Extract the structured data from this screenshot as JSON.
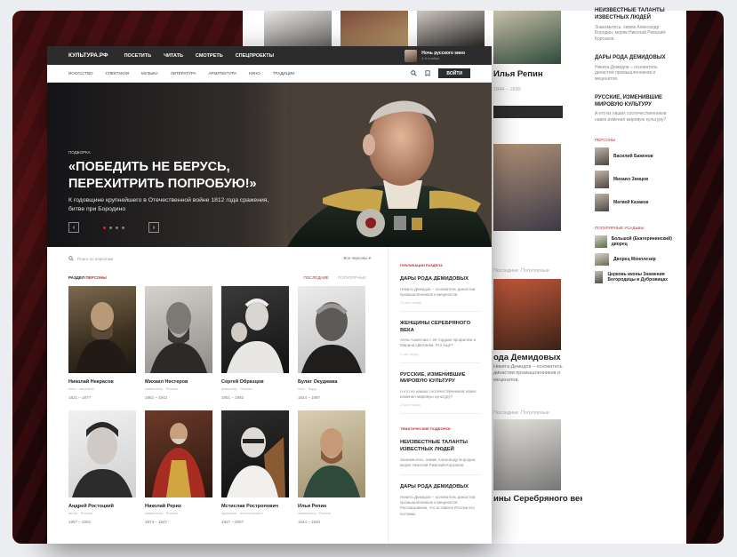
{
  "header": {
    "logo": "КУЛЬТУРА.РФ",
    "nav": [
      "ПОСЕТИТЬ",
      "ЧИТАТЬ",
      "СМОТРЕТЬ",
      "СПЕЦПРОЕКТЫ"
    ],
    "promo_title": "Ночь русского кино",
    "promo_sub": "4-5 ноября"
  },
  "subnav": {
    "items": [
      "Искусство",
      "Спектакли",
      "Музыка",
      "Литература",
      "Архитектура",
      "Кино",
      "Традиции"
    ],
    "login": "Войти"
  },
  "hero": {
    "kicker": "Подборка",
    "title": "«ПОБЕДИТЬ НЕ БЕРУСЬ, ПЕРЕХИТРИТЬ ПОПРОБУЮ!»",
    "subtitle": "К годовщине крупнейшего в Отечественной войне 1812 года сражения, битве при Бородино",
    "prev": "‹",
    "next": "›"
  },
  "search": {
    "placeholder": "Поиск по персонам",
    "filter": "Все персоны ▾"
  },
  "section": {
    "label_prefix": "Раздел",
    "label_accent": "персоны",
    "tab_recent": "Последние",
    "tab_popular": "Популярные"
  },
  "persons": [
    {
      "name": "Николай Некрасов",
      "role": "поэт · писатель",
      "years": "1821 – 1877"
    },
    {
      "name": "Михаил Нестеров",
      "role": "живописец · Россия",
      "years": "1862 – 1942"
    },
    {
      "name": "Сергей Образцов",
      "role": "режиссёр · Россия",
      "years": "1901 – 1992"
    },
    {
      "name": "Булат Окуджава",
      "role": "поэт · бард",
      "years": "1924 – 1997"
    },
    {
      "name": "Андрей Ростоцкий",
      "role": "актёр · Россия",
      "years": "1957 – 2002"
    },
    {
      "name": "Николай Рерих",
      "role": "живописец · Россия",
      "years": "1874 – 1947"
    },
    {
      "name": "Мстислав Ростропович",
      "role": "музыкант · виолончелист",
      "years": "1927 – 2007"
    },
    {
      "name": "Илья Репин",
      "role": "живописец · Россия",
      "years": "1844 – 1930"
    }
  ],
  "sidebar": {
    "pub_label": "Публикации раздела",
    "pubs": [
      {
        "title": "Дары рода Демидовых",
        "text": "Никита Демидов – основатель династии промышленников и меценатов.",
        "meta": "12 мин назад"
      },
      {
        "title": "Женщины Серебряного века",
        "text": "Анна Ахматова с её гордым профилем и Марина Цветаева. Кто ещё?",
        "meta": "1 час назад"
      },
      {
        "title": "Русские, изменившие мировую культуру",
        "text": "А кто из наших соотечественников навек изменил мировую культуру?",
        "meta": "2 часа назад"
      }
    ],
    "themes_label": "Тематические подборки",
    "themes": [
      {
        "title": "Неизвестные таланты известных людей",
        "text": "Знакомьтесь: химик Александр Бородин, моряк Николай Римский-Корсаков."
      },
      {
        "title": "Дары рода Демидовых",
        "text": "Никита Демидов – основатель династии промышленников и меценатов. Рассказываем, что оставили России его потомки."
      }
    ]
  },
  "back": {
    "repin_name": "Илья Репин",
    "repin_years": "1844 – 1930",
    "demid_title": "ода Демидовых",
    "silver_title": "ины Серебряного века",
    "tab_recent": "Последние",
    "tab_popular": "Популярные",
    "side_t1": "Неизвестные таланты известных людей",
    "side_x1": "Знакомьтесь: химик Александр Бородин, моряк Николай Римский-Корсаков.",
    "side_t2": "Дары рода Демидовых",
    "side_x2": "Никита Демидов – основатель династии промышленников и меценатов.",
    "side_t3": "Русские, изменившие мировую культуру",
    "side_x3": "А кто из наших соотечественников навек изменил мировую культуру?",
    "persons_label": "Персоны",
    "p1": "Василий Баженов",
    "p2": "Михаил Земцов",
    "p3": "Матвей Казаков",
    "places_label": "Популярные усадьбы",
    "pl1": "Большой (Екатерининский) дворец",
    "pl2": "Дворец Монплезир",
    "pl3": "Церковь иконы Знамения Богородицы в Дубровицах"
  },
  "colors": {
    "accent": "#c8282b",
    "dark": "#2c2c2e"
  }
}
